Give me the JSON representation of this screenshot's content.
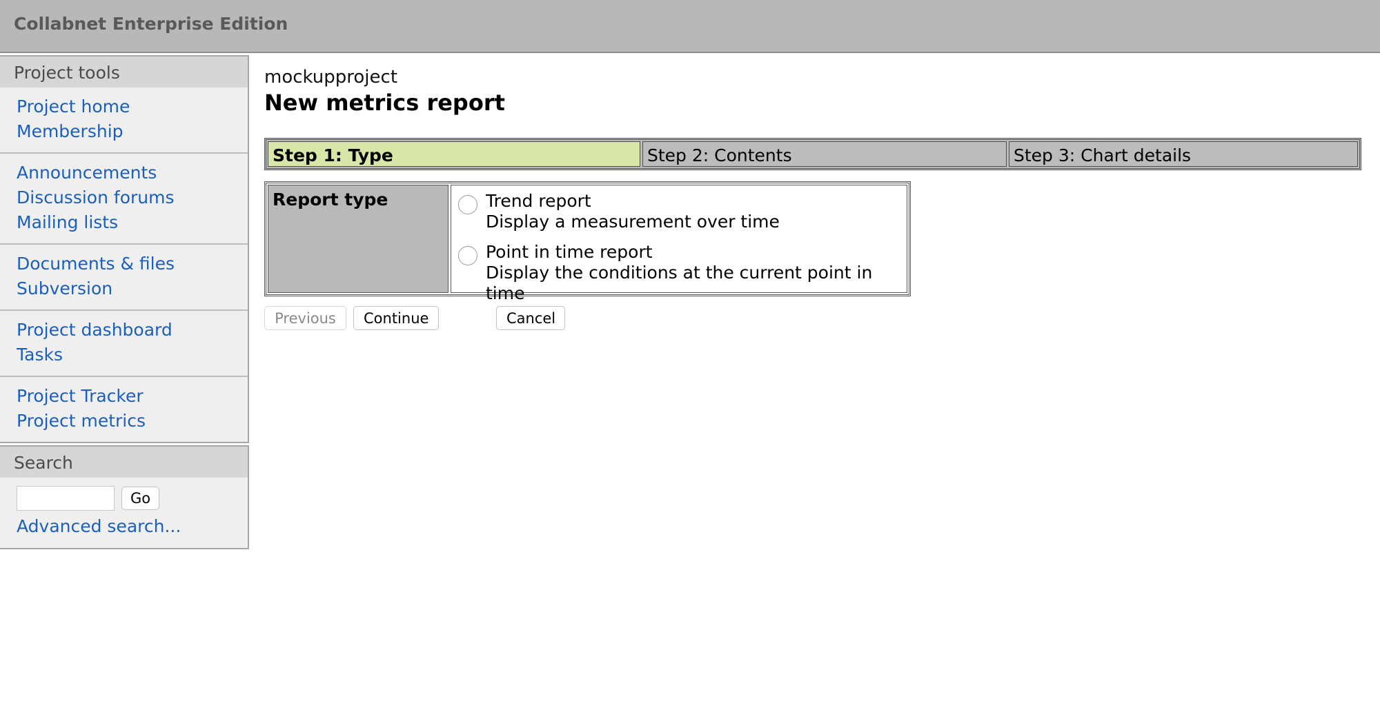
{
  "header": {
    "title": "Collabnet Enterprise Edition"
  },
  "sidebar": {
    "project_tools_label": "Project tools",
    "groups": [
      [
        "Project home",
        "Membership"
      ],
      [
        "Announcements",
        "Discussion forums",
        "Mailing lists"
      ],
      [
        "Documents & files",
        "Subversion"
      ],
      [
        "Project dashboard",
        "Tasks"
      ],
      [
        "Project Tracker",
        "Project metrics"
      ]
    ],
    "search": {
      "label": "Search",
      "input_value": "",
      "go_label": "Go",
      "advanced_label": "Advanced search..."
    }
  },
  "main": {
    "project_name": "mockupproject",
    "page_title": "New metrics report",
    "steps": [
      "Step 1: Type",
      "Step 2: Contents",
      "Step 3: Chart details"
    ],
    "active_step": 1,
    "report_type_label": "Report type",
    "options": [
      {
        "title": "Trend report",
        "description": "Display a measurement over time",
        "selected": false
      },
      {
        "title": "Point in time report",
        "description": "Display the conditions at the current point in time",
        "selected": false
      }
    ],
    "buttons": {
      "previous": "Previous",
      "continue": "Continue",
      "cancel": "Cancel"
    }
  },
  "colors": {
    "header_bg": "#b8b8b8",
    "link": "#1b5fbd",
    "active_step_bg": "#d8e6a8"
  }
}
